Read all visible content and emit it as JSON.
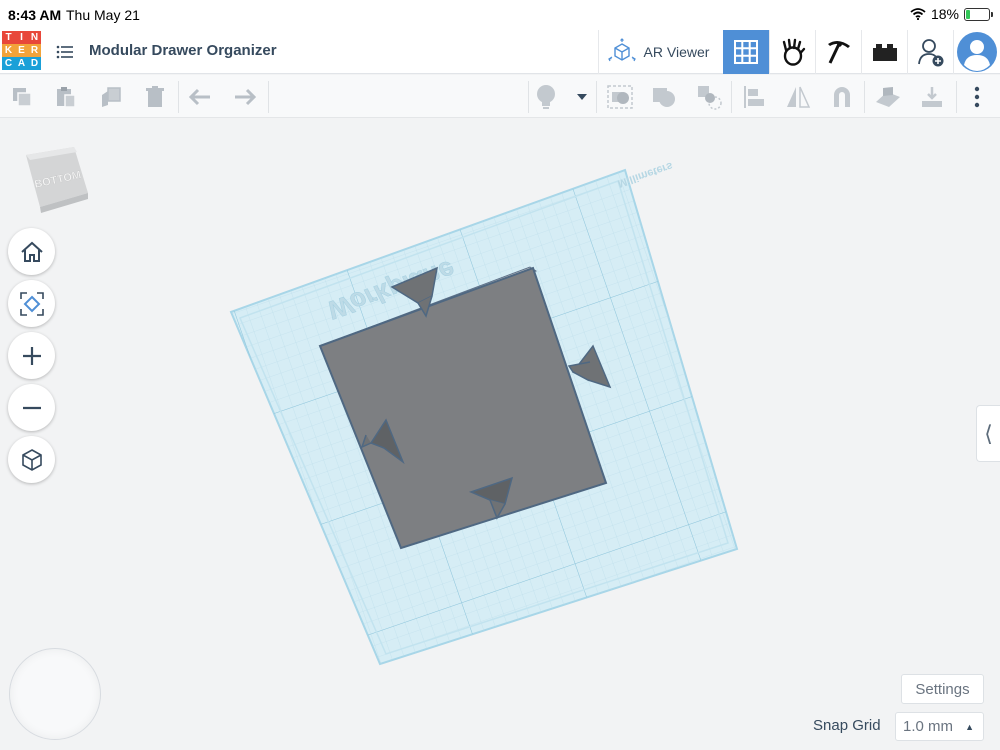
{
  "status_bar": {
    "time": "8:43 AM",
    "date": "Thu May 21",
    "battery_percent": "18%",
    "battery_level": 0.18
  },
  "app": {
    "logo_letters": [
      "T",
      "I",
      "N",
      "K",
      "E",
      "R",
      "C",
      "A",
      "D"
    ],
    "logo_colors": [
      "#e8473a",
      "#e8473a",
      "#e8473a",
      "#f2a33a",
      "#f2a33a",
      "#f2a33a",
      "#1aa0d8",
      "#1aa0d8",
      "#1aa0d8"
    ],
    "document_title": "Modular Drawer Organizer"
  },
  "header": {
    "ar_viewer_label": "AR Viewer",
    "buttons": [
      "grid-icon",
      "handprint-icon",
      "pickaxe-icon",
      "brick-icon",
      "add-user-icon",
      "avatar"
    ]
  },
  "toolbar": {
    "left_tools": [
      "copy-icon",
      "paste-icon",
      "duplicate-icon",
      "delete-icon",
      "undo-icon",
      "redo-icon"
    ],
    "right_tools": [
      "lightbulb-icon",
      "dropdown-icon",
      "group-icon",
      "union-icon",
      "ungroup-icon",
      "align-icon",
      "mirror-icon",
      "magnet-icon",
      "workplane-icon",
      "drop-icon",
      "more-icon"
    ]
  },
  "canvas": {
    "viewcube_label": "BOTTOM",
    "workplane_label": "Workplane",
    "units_label": "Millimeters"
  },
  "bottom": {
    "settings_label": "Settings",
    "snap_grid_label": "Snap Grid",
    "snap_grid_value": "1.0 mm"
  },
  "colors": {
    "accent": "#4f8fd6",
    "shape_fill": "#7d7f82",
    "workplane": "#d6edf5"
  }
}
